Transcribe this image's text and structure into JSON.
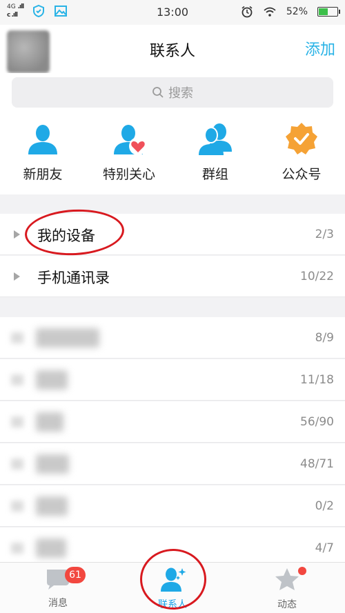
{
  "status_bar": {
    "network": "4G",
    "time": "13:00",
    "battery": "52%",
    "battery_level": 0.52
  },
  "header": {
    "title": "联系人",
    "add_label": "添加"
  },
  "search": {
    "placeholder": "搜索"
  },
  "quick_entries": [
    {
      "label": "新朋友",
      "icon": "person-icon"
    },
    {
      "label": "特别关心",
      "icon": "person-heart-icon"
    },
    {
      "label": "群组",
      "icon": "group-icon"
    },
    {
      "label": "公众号",
      "icon": "verified-badge-icon"
    }
  ],
  "special_groups": [
    {
      "name": "我的设备",
      "count": "2/3"
    },
    {
      "name": "手机通讯录",
      "count": "10/22"
    }
  ],
  "friend_groups": [
    {
      "count": "8/9"
    },
    {
      "count": "11/18"
    },
    {
      "count": "56/90"
    },
    {
      "count": "48/71"
    },
    {
      "count": "0/2"
    },
    {
      "count": "4/7"
    }
  ],
  "tabbar": {
    "messages": {
      "label": "消息",
      "badge": "61"
    },
    "contacts": {
      "label": "联系人"
    },
    "feeds": {
      "label": "动态"
    }
  },
  "colors": {
    "accent": "#29b3e6",
    "badge": "#f2473f",
    "annotation": "#d8191f"
  }
}
